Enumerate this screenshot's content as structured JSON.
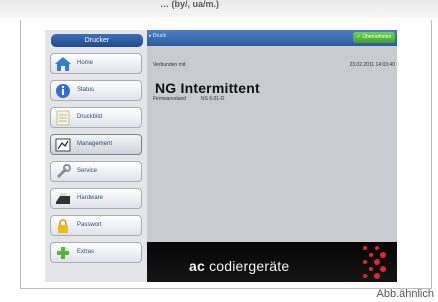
{
  "page": {
    "top_caption": "… (by/, ua/m.)",
    "footer_caption": "Abb.ähnlich"
  },
  "sidebar": {
    "header": "Drucker",
    "items": [
      {
        "label": "Home",
        "icon": "home-icon"
      },
      {
        "label": "Status",
        "icon": "info-icon"
      },
      {
        "label": "Druckbild",
        "icon": "document-icon"
      },
      {
        "label": "Management",
        "icon": "management-icon",
        "active": true
      },
      {
        "label": "Service",
        "icon": "wrench-icon"
      },
      {
        "label": "Hardware",
        "icon": "printer-icon"
      },
      {
        "label": "Passwort",
        "icon": "lock-icon"
      },
      {
        "label": "Extras",
        "icon": "plus-icon"
      }
    ]
  },
  "main": {
    "topbar": {
      "back_label": "▸ Druck",
      "button_label": "✓ Übernehmen"
    },
    "connected_label": "Verbunden mit",
    "timestamp": "23.02.2011 14:03:40",
    "device_name": "NG  Intermittent",
    "firmware_label": "Firmwarestand",
    "firmware_value": "NS 6.01-D"
  },
  "footer": {
    "brand_prefix": "ac",
    "brand_name": " codiergeräte"
  },
  "colors": {
    "accent": "#2b5aa0",
    "green": "#3fa52c",
    "logo_red": "#e3262d"
  }
}
